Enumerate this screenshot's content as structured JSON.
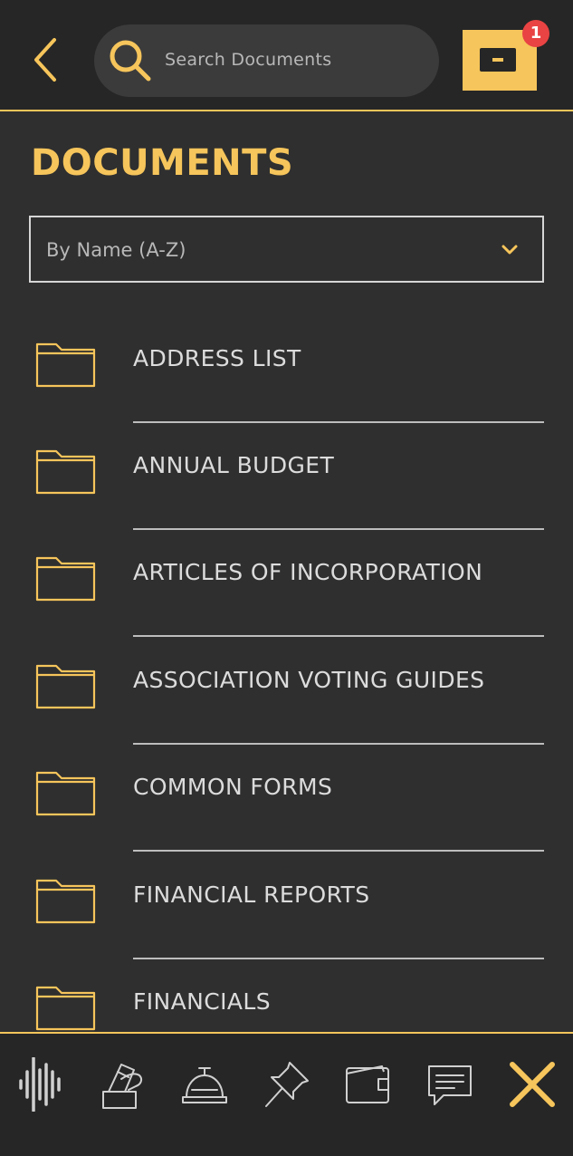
{
  "header": {
    "search_placeholder": "Search Documents",
    "notification_count": "1"
  },
  "page": {
    "title": "DOCUMENTS",
    "sort": {
      "selected": "By Name (A-Z)"
    }
  },
  "documents": [
    {
      "label": "ADDRESS LIST"
    },
    {
      "label": "ANNUAL BUDGET"
    },
    {
      "label": "ARTICLES OF INCORPORATION"
    },
    {
      "label": "ASSOCIATION VOTING GUIDES"
    },
    {
      "label": "COMMON FORMS"
    },
    {
      "label": "FINANCIAL REPORTS"
    },
    {
      "label": "FINANCIALS"
    }
  ],
  "bottom_nav": {
    "items": [
      {
        "icon": "audio-waveform-icon"
      },
      {
        "icon": "hand-vote-icon"
      },
      {
        "icon": "service-bell-icon"
      },
      {
        "icon": "pushpin-icon"
      },
      {
        "icon": "wallet-icon"
      },
      {
        "icon": "chat-bubble-icon"
      },
      {
        "icon": "close-icon"
      }
    ]
  },
  "colors": {
    "accent": "#f6c55b",
    "background": "#2f2f2f",
    "header_bg": "#262626",
    "badge": "#e94343"
  }
}
